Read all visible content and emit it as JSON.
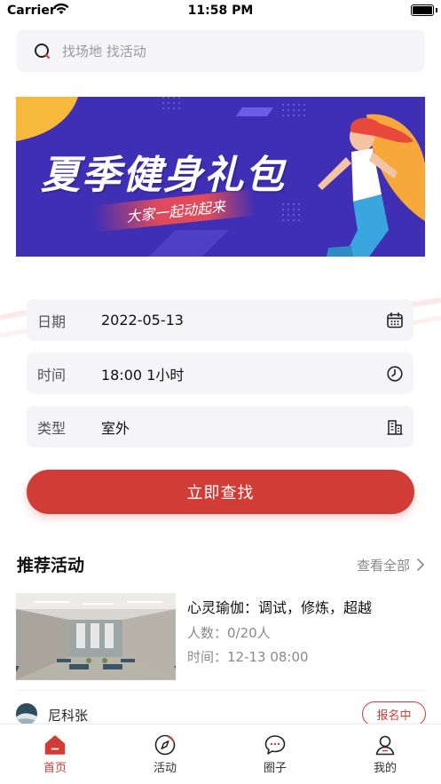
{
  "status_bar": {
    "carrier": "Carrier",
    "time": "11:58 PM"
  },
  "search": {
    "placeholder": "找场地 找活动",
    "icon": "search-icon"
  },
  "banner": {
    "title": "夏季健身礼包",
    "subtitle": "大家一起动起来"
  },
  "form": {
    "date": {
      "label": "日期",
      "value": "2022-05-13",
      "icon": "calendar-icon"
    },
    "time": {
      "label": "时间",
      "value": "18:00 1小时",
      "icon": "clock-icon"
    },
    "type": {
      "label": "类型",
      "value": "室外",
      "icon": "building-icon"
    }
  },
  "search_button": "立即查找",
  "recommend": {
    "title": "推荐活动",
    "view_all": "查看全部",
    "activity": {
      "name": "心灵瑜伽：调试，修炼，超越",
      "people": "人数：0/20人",
      "time": "时间：12-13 08:00",
      "host": "尼科张",
      "status": "报名中"
    }
  },
  "tabs": [
    {
      "label": "首页",
      "icon": "home-icon",
      "active": true
    },
    {
      "label": "活动",
      "icon": "compass-icon",
      "active": false
    },
    {
      "label": "圈子",
      "icon": "chat-bubble-icon",
      "active": false
    },
    {
      "label": "我的",
      "icon": "user-icon",
      "active": false
    }
  ],
  "colors": {
    "accent": "#d23c36",
    "banner_bg": "#3f2fb5",
    "field_bg": "#f5f5f7"
  }
}
